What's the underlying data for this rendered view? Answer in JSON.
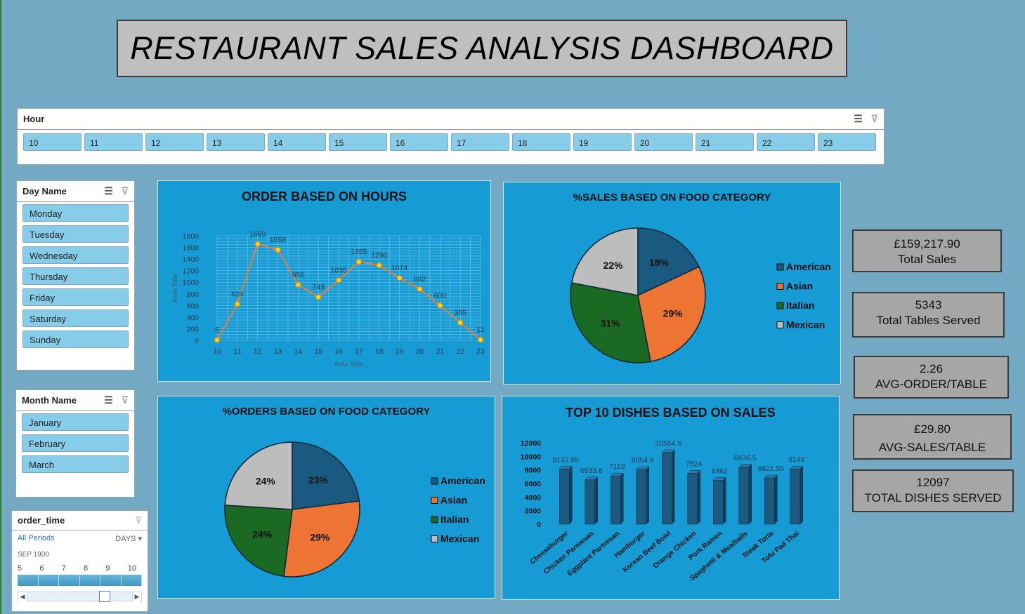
{
  "dashboard_title": "RESTAURANT SALES ANALYSIS DASHBOARD",
  "hour_slicer": {
    "title": "Hour",
    "items": [
      "10",
      "11",
      "12",
      "13",
      "14",
      "15",
      "16",
      "17",
      "18",
      "19",
      "20",
      "21",
      "22",
      "23"
    ]
  },
  "day_slicer": {
    "title": "Day Name",
    "items": [
      "Monday",
      "Tuesday",
      "Wednesday",
      "Thursday",
      "Friday",
      "Saturday",
      "Sunday"
    ]
  },
  "month_slicer": {
    "title": "Month Name",
    "items": [
      "January",
      "February",
      "March"
    ]
  },
  "timeline": {
    "title": "order_time",
    "periods_label": "All Periods",
    "level_label": "DAYS",
    "month_label": "SEP 1900",
    "day_numbers": [
      "5",
      "6",
      "7",
      "8",
      "9",
      "10"
    ]
  },
  "kpis": [
    {
      "value": "£159,217.90",
      "label": "Total Sales"
    },
    {
      "value": "5343",
      "label": "Total Tables Served"
    },
    {
      "value": "2.26",
      "label": "AVG-ORDER/TABLE"
    },
    {
      "value": "£29.80",
      "label": "AVG-SALES/TABLE"
    },
    {
      "value": "12097",
      "label": "TOTAL DISHES SERVED"
    }
  ],
  "colors": {
    "background": "#73a9c2",
    "panel": "#169bd5",
    "american": "#1a5a80",
    "asian": "#ed7432",
    "italian": "#1b6a24",
    "mexican": "#bdbdbd",
    "line": "#ed7d31",
    "marker": "#ffd700"
  },
  "icons": {
    "multiselect": "multiselect-icon",
    "clear_filter": "clear-filter-icon"
  },
  "chart_data": [
    {
      "type": "line",
      "title": "ORDER BASED ON HOURS",
      "xlabel": "Axis Title",
      "ylabel": "Axis Title",
      "x": [
        10,
        11,
        12,
        13,
        14,
        15,
        16,
        17,
        18,
        19,
        20,
        21,
        22,
        23
      ],
      "values": [
        5,
        624,
        1659,
        1558,
        956,
        743,
        1035,
        1355,
        1290,
        1074,
        882,
        600,
        305,
        11
      ],
      "ylim": [
        0,
        1800
      ],
      "yticks": [
        0,
        200,
        400,
        600,
        800,
        1000,
        1200,
        1400,
        1600,
        1800
      ],
      "grid": true
    },
    {
      "type": "pie",
      "title": "%SALES BASED ON FOOD CATEGORY",
      "categories": [
        "American",
        "Asian",
        "Italian",
        "Mexican"
      ],
      "values": [
        18,
        29,
        31,
        22
      ],
      "labels": [
        "18%",
        "29%",
        "31%",
        "22%"
      ],
      "legend": "right"
    },
    {
      "type": "pie",
      "title": "%ORDERS BASED ON FOOD CATEGORY",
      "categories": [
        "American",
        "Asian",
        "Italian",
        "Mexican"
      ],
      "values": [
        23,
        29,
        24,
        24
      ],
      "labels": [
        "23%",
        "29%",
        "24%",
        "24%"
      ],
      "legend": "right"
    },
    {
      "type": "bar",
      "title": "TOP 10 DISHES BASED ON SALES",
      "categories": [
        "Cheeseburger",
        "Chicken Parmesan",
        "Eggplant Parmesan",
        "Hamburger",
        "Korean Beef Bowl",
        "Orange Chicken",
        "Pork Ramen",
        "Spaghetti & Meatballs",
        "Steak Torta",
        "Tofu Pad Thai"
      ],
      "values": [
        8132.85,
        6533.8,
        7119,
        8054.9,
        10554.6,
        7524,
        6462,
        8436.5,
        6821.55,
        8149
      ],
      "ylim": [
        0,
        12000
      ],
      "yticks": [
        0,
        2000,
        4000,
        6000,
        8000,
        10000,
        12000
      ]
    }
  ]
}
